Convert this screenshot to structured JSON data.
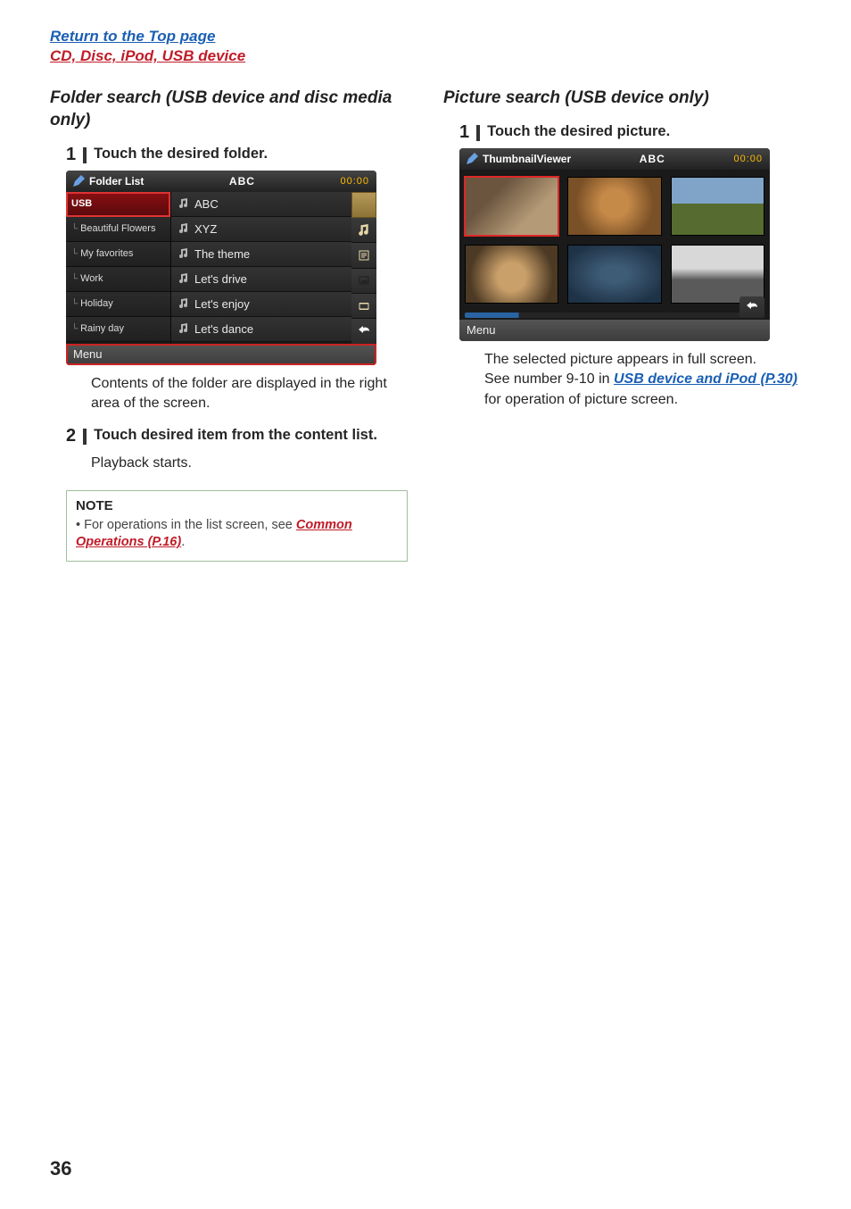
{
  "header": {
    "top_link": "Return to the Top page",
    "section_link": "CD, Disc, iPod, USB device"
  },
  "left": {
    "title": "Folder search (USB device and disc media only)",
    "step1": {
      "num": "1",
      "text": "Touch the desired folder."
    },
    "step1_body": "Contents of the folder are displayed in the right area of the screen.",
    "step2": {
      "num": "2",
      "text": "Touch desired item from the content list."
    },
    "step2_body": "Playback starts.",
    "note": {
      "title": "NOTE",
      "bullet_prefix": "• For operations in the list screen, see ",
      "link": "Common Operations (P.16)",
      "suffix": "."
    },
    "shot": {
      "title": "Folder List",
      "center": "ABC",
      "clock": "00:00",
      "folders": [
        "USB",
        "Beautiful Flowers",
        "My favorites",
        "Work",
        "Holiday",
        "Rainy day"
      ],
      "tracks": [
        "ABC",
        "XYZ",
        "The theme",
        "Let's drive",
        "Let's enjoy",
        "Let's dance"
      ],
      "side_icons": [
        "scroll",
        "music",
        "text",
        "picture",
        "video",
        "back"
      ],
      "menu": "Menu"
    }
  },
  "right": {
    "title": "Picture search (USB device only)",
    "step1": {
      "num": "1",
      "text": "Touch the desired picture."
    },
    "step1_body1": "The selected picture appears in full screen.",
    "step1_body2a": "See number 9-10 in ",
    "step1_link": "USB device and iPod (P.30)",
    "step1_body2b": " for operation of picture screen.",
    "shot": {
      "title": "ThumbnailViewer",
      "center": "ABC",
      "clock": "00:00",
      "menu": "Menu"
    }
  },
  "page_number": "36"
}
